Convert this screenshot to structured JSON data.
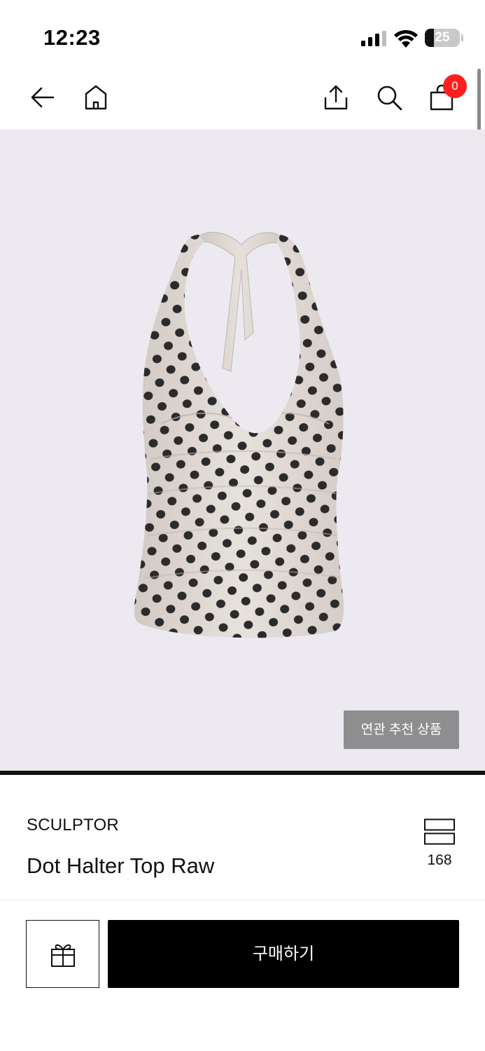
{
  "status_bar": {
    "time": "12:23",
    "battery_percent": "25",
    "battery_level": 0.25,
    "signal_icon": "signal-bars-icon",
    "wifi_icon": "wifi-icon"
  },
  "nav": {
    "back_icon": "arrow-left-icon",
    "home_icon": "home-icon",
    "share_icon": "share-icon",
    "search_icon": "search-icon",
    "cart_icon": "shopping-bag-icon",
    "cart_count": "0"
  },
  "product": {
    "image_description_icon": "polka-dot-halter-top",
    "related_button_label": "연관 추천 상품",
    "brand": "SCULPTOR",
    "name": "Dot Halter Top Raw",
    "like_icon": "wishlist-icon",
    "like_count": "168"
  },
  "actions": {
    "gift_icon": "gift-icon",
    "buy_label": "구매하기"
  },
  "colors": {
    "badge": "#ff1e1e",
    "image_background": "#eceaf0",
    "buy_button": "#000000",
    "related_button": "#8e8e90"
  }
}
